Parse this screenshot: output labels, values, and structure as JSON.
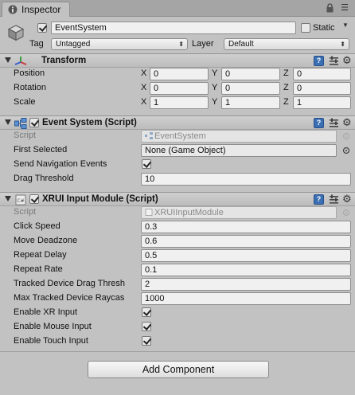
{
  "tab": {
    "title": "Inspector",
    "icon": "info-icon"
  },
  "gameobject": {
    "active": true,
    "name": "EventSystem",
    "static_label": "Static",
    "static_checked": false,
    "tag_label": "Tag",
    "tag_value": "Untagged",
    "layer_label": "Layer",
    "layer_value": "Default"
  },
  "transform": {
    "title": "Transform",
    "rows": [
      {
        "label": "Position",
        "x": "0",
        "y": "0",
        "z": "0"
      },
      {
        "label": "Rotation",
        "x": "0",
        "y": "0",
        "z": "0"
      },
      {
        "label": "Scale",
        "x": "1",
        "y": "1",
        "z": "1"
      }
    ],
    "axis_labels": [
      "X",
      "Y",
      "Z"
    ]
  },
  "event_system": {
    "title": "Event System (Script)",
    "enabled": true,
    "script_label": "Script",
    "script_value": "EventSystem",
    "first_selected_label": "First Selected",
    "first_selected_value": "None (Game Object)",
    "send_nav_label": "Send Navigation Events",
    "send_nav_checked": true,
    "drag_threshold_label": "Drag Threshold",
    "drag_threshold_value": "10"
  },
  "xrui": {
    "title": "XRUI Input Module (Script)",
    "enabled": true,
    "script_label": "Script",
    "script_value": "XRUIInputModule",
    "fields": [
      {
        "label": "Click Speed",
        "value": "0.3"
      },
      {
        "label": "Move Deadzone",
        "value": "0.6"
      },
      {
        "label": "Repeat Delay",
        "value": "0.5"
      },
      {
        "label": "Repeat Rate",
        "value": "0.1"
      },
      {
        "label": "Tracked Device Drag Thresh",
        "value": "2"
      },
      {
        "label": "Max Tracked Device Raycas",
        "value": "1000"
      }
    ],
    "toggles": [
      {
        "label": "Enable XR Input",
        "checked": true
      },
      {
        "label": "Enable Mouse Input",
        "checked": true
      },
      {
        "label": "Enable Touch Input",
        "checked": true
      }
    ]
  },
  "add_component_label": "Add Component"
}
